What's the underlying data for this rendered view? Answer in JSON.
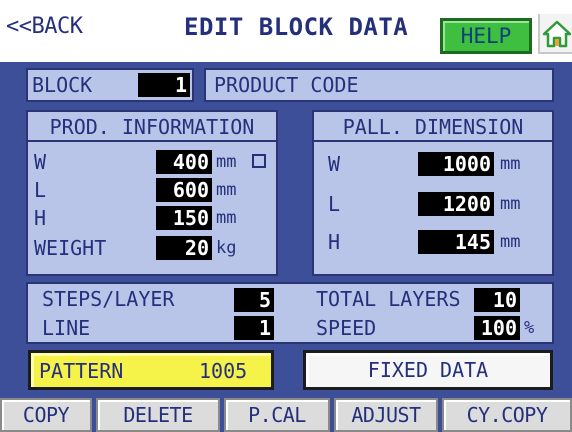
{
  "header": {
    "back_label": "<<BACK",
    "title": "EDIT BLOCK DATA",
    "help_label": "HELP",
    "home_icon": "home-icon"
  },
  "block": {
    "label": "BLOCK",
    "value": "1",
    "product_code_label": "PRODUCT CODE",
    "product_code_value": ""
  },
  "prod_info": {
    "title": "PROD. INFORMATION",
    "rows": [
      {
        "label": "W",
        "value": "400",
        "unit": "mm"
      },
      {
        "label": "L",
        "value": "600",
        "unit": "mm"
      },
      {
        "label": "H",
        "value": "150",
        "unit": "mm"
      },
      {
        "label": "WEIGHT",
        "value": "20",
        "unit": "kg"
      }
    ]
  },
  "pall_dim": {
    "title": "PALL. DIMENSION",
    "rows": [
      {
        "label": "W",
        "value": "1000",
        "unit": "mm"
      },
      {
        "label": "L",
        "value": "1200",
        "unit": "mm"
      },
      {
        "label": "H",
        "value": "145",
        "unit": "mm"
      }
    ]
  },
  "layer": {
    "steps_label": "STEPS/LAYER",
    "steps_value": "5",
    "total_label": "TOTAL LAYERS",
    "total_value": "10",
    "line_label": "LINE",
    "line_value": "1",
    "speed_label": "SPEED",
    "speed_value": "100",
    "speed_unit": "%"
  },
  "pattern": {
    "label": "PATTERN",
    "value": "1005"
  },
  "fixed_data_label": "FIXED DATA",
  "function_buttons": {
    "copy": "COPY",
    "delete": "DELETE",
    "pcal": "P.CAL",
    "adjust": "ADJUST",
    "cycopy": "CY.COPY"
  },
  "colors": {
    "panel_background": "#3d4f98",
    "box_fill": "#b8c5e8",
    "help_green": "#3fbf3f",
    "pattern_yellow": "#f5f24a"
  }
}
